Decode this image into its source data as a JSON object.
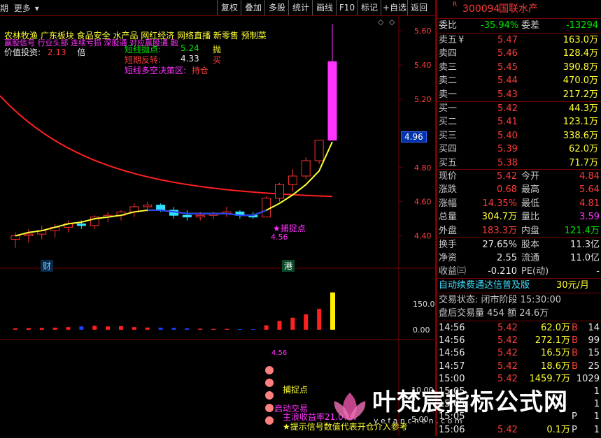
{
  "toolbar": {
    "left_label": "期",
    "more_label": "更多",
    "dropdown_glyph": "▾",
    "buttons": [
      "复权",
      "叠加",
      "多股",
      "统计",
      "画线",
      "F10",
      "标记",
      "+自选",
      "返回"
    ]
  },
  "stock": {
    "flag": "R",
    "code": "300094",
    "name": "国联水产"
  },
  "concepts": "农林牧渔  广东板块  食品安全 水产品 网红经济 网络直播 新零售 预制菜",
  "overlay": {
    "line1": "赢股信号  行业头部  连续亏损  深股通  对应赢股通  融",
    "value_invest_label": "价值投资:",
    "value_invest_value": "2.13",
    "value_invest_unit": "倍",
    "short_point_label": "短线抛点:",
    "short_point_value": "5.24",
    "short_point_action": "抛",
    "short_rev_label": "短期反转:",
    "short_rev_value": "4.33",
    "short_rev_action": "买",
    "short_zone_label": "短线多空决策区:",
    "short_zone_action": "持仓",
    "capture_label": "★捕捉点",
    "capture_value": "4.56",
    "cai_tag": "财",
    "gang_tag": "港",
    "current_price_tag": "4.96"
  },
  "lower_panel": {
    "capture_value": "4.56",
    "capture_label": "捕捉点",
    "start_trade": "启动交易",
    "main_return": "主浪收益率21.07%",
    "tip": "★提示信号数值代表开仓介入参考"
  },
  "axes": {
    "price_ticks": [
      "5.60",
      "5.40",
      "5.20",
      "4.80",
      "4.60",
      "4.40"
    ],
    "vol_ticks": [
      "150.00",
      "0.00"
    ],
    "lower_ticks": [
      "10.00",
      "5.00"
    ]
  },
  "chart_data": {
    "type": "candlestick",
    "series": [
      {
        "name": "K线",
        "values": [
          [
            4.38,
            4.42,
            4.33,
            4.4
          ],
          [
            4.4,
            4.44,
            4.36,
            4.41
          ],
          [
            4.41,
            4.46,
            4.38,
            4.43
          ],
          [
            4.43,
            4.47,
            4.39,
            4.45
          ],
          [
            4.45,
            4.49,
            4.42,
            4.47
          ],
          [
            4.47,
            4.49,
            4.44,
            4.46
          ],
          [
            4.46,
            4.52,
            4.44,
            4.51
          ],
          [
            4.51,
            4.54,
            4.48,
            4.52
          ],
          [
            4.52,
            4.55,
            4.49,
            4.54
          ],
          [
            4.54,
            4.59,
            4.51,
            4.57
          ],
          [
            4.57,
            4.6,
            4.54,
            4.58
          ],
          [
            4.58,
            4.59,
            4.54,
            4.55
          ],
          [
            4.55,
            4.57,
            4.5,
            4.52
          ],
          [
            4.52,
            4.55,
            4.49,
            4.51
          ],
          [
            4.51,
            4.54,
            4.49,
            4.52
          ],
          [
            4.52,
            4.54,
            4.5,
            4.53
          ],
          [
            4.53,
            4.57,
            4.51,
            4.54
          ],
          [
            4.54,
            4.55,
            4.5,
            4.52
          ],
          [
            4.52,
            4.54,
            4.5,
            4.51
          ],
          [
            4.51,
            4.63,
            4.51,
            4.62
          ],
          [
            4.62,
            4.71,
            4.6,
            4.7
          ],
          [
            4.7,
            4.79,
            4.66,
            4.75
          ],
          [
            4.75,
            4.86,
            4.73,
            4.84
          ],
          [
            4.84,
            4.96,
            4.82,
            4.96
          ],
          [
            4.96,
            5.64,
            4.96,
            5.42
          ]
        ]
      },
      {
        "name": "MA",
        "values": [
          4.4,
          4.42,
          4.43,
          4.45,
          4.47,
          4.48,
          4.5,
          4.51,
          4.52,
          4.54,
          4.55,
          4.55,
          4.54,
          4.53,
          4.53,
          4.53,
          4.53,
          4.52,
          4.52,
          4.55,
          4.59,
          4.64,
          4.7,
          4.78,
          4.95
        ]
      },
      {
        "name": "量",
        "values": [
          6,
          7,
          8,
          9,
          12,
          15,
          18,
          15,
          16,
          12,
          10,
          9,
          8,
          6,
          5,
          4,
          4,
          3,
          3,
          20,
          40,
          55,
          70,
          95,
          170
        ]
      }
    ],
    "ylim": [
      4.3,
      5.65
    ]
  },
  "quote": {
    "weibi_label": "委比",
    "weibi_value": "-35.94%",
    "weicha_label": "委差",
    "weicha_value": "-13294",
    "asks": [
      {
        "label": "卖五",
        "mark": "¥",
        "price": "5.47",
        "vol": "163.0万"
      },
      {
        "label": "卖四",
        "mark": "",
        "price": "5.46",
        "vol": "128.4万"
      },
      {
        "label": "卖三",
        "mark": "",
        "price": "5.45",
        "vol": "390.8万"
      },
      {
        "label": "卖二",
        "mark": "",
        "price": "5.44",
        "vol": "470.0万"
      },
      {
        "label": "卖一",
        "mark": "",
        "price": "5.43",
        "vol": "217.2万"
      }
    ],
    "bids": [
      {
        "label": "买一",
        "price": "5.42",
        "vol": "44.3万"
      },
      {
        "label": "买二",
        "price": "5.41",
        "vol": "123.1万"
      },
      {
        "label": "买三",
        "price": "5.40",
        "vol": "338.6万"
      },
      {
        "label": "买四",
        "price": "5.39",
        "vol": "62.0万"
      },
      {
        "label": "买五",
        "price": "5.38",
        "vol": "71.7万"
      }
    ],
    "stats": [
      {
        "l1": "现价",
        "v1": "5.42",
        "c1": "red",
        "l2": "今开",
        "v2": "4.84",
        "c2": "red"
      },
      {
        "l1": "涨跌",
        "v1": "0.68",
        "c1": "red",
        "l2": "最高",
        "v2": "5.64",
        "c2": "red"
      },
      {
        "l1": "涨幅",
        "v1": "14.35%",
        "c1": "red",
        "l2": "最低",
        "v2": "4.81",
        "c2": "red"
      },
      {
        "l1": "总量",
        "v1": "304.7万",
        "c1": "yel",
        "l2": "量比",
        "v2": "3.59",
        "c2": "mag"
      },
      {
        "l1": "外盘",
        "v1": "183.3万",
        "c1": "red",
        "l2": "内盘",
        "v2": "121.4万",
        "c2": "grn"
      }
    ],
    "stats2": [
      {
        "l1": "换手",
        "v1": "27.65%",
        "l2": "股本",
        "v2": "11.3亿"
      },
      {
        "l1": "净资",
        "v1": "2.55",
        "l2": "流通",
        "v2": "11.0亿"
      },
      {
        "l1": "收益㈢",
        "v1": "-0.210",
        "l2": "PE(动)",
        "v2": "-"
      }
    ],
    "ad_text": "自动续费通达信普及版",
    "ad_price": "30元/月",
    "trade_status": "交易状态: 闭市阶段 15:30:00",
    "after_hours": "盘后交易量 454 额 24.6万",
    "ticks": [
      {
        "time": "14:56",
        "price": "5.42",
        "vol": "62.0万",
        "side": "B",
        "n": "14"
      },
      {
        "time": "14:56",
        "price": "5.42",
        "vol": "272.1万",
        "side": "B",
        "n": "99"
      },
      {
        "time": "14:56",
        "price": "5.42",
        "vol": "16.5万",
        "side": "B",
        "n": "15"
      },
      {
        "time": "14:57",
        "price": "5.42",
        "vol": "18.6万",
        "side": "B",
        "n": "25"
      },
      {
        "time": "15:00",
        "price": "5.42",
        "vol": "1459.7万",
        "side": "",
        "n": "1029"
      },
      {
        "time": "15:05",
        "price": "",
        "vol": "",
        "side": "",
        "n": "1"
      },
      {
        "time": "15:05",
        "price": "",
        "vol": "",
        "side": "",
        "n": "1"
      },
      {
        "time": "15:05",
        "price": "",
        "vol": "",
        "side": "P",
        "n": "1"
      },
      {
        "time": "15:06",
        "price": "5.42",
        "vol": "0.1万",
        "side": "P",
        "n": "1"
      }
    ]
  },
  "watermark": {
    "title": "叶梵宸指标公式网",
    "url": "y e f a n c h e n . c o m"
  }
}
